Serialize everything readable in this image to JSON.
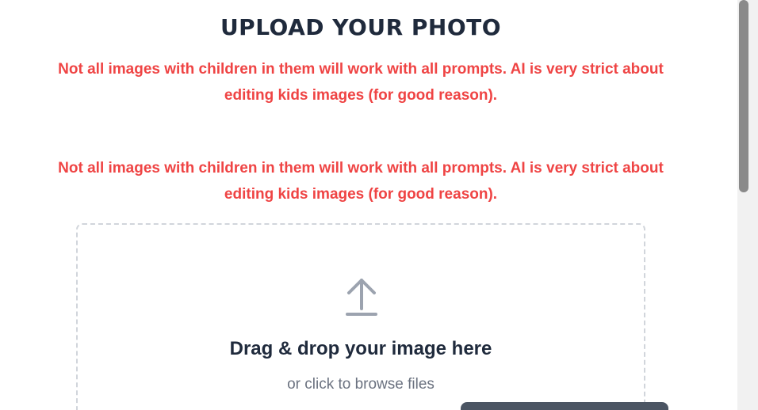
{
  "header": {
    "title": "Upload Your Photo"
  },
  "warnings": [
    "Not all images with children in them will work with all prompts. AI is very strict about editing kids images (for good reason).",
    "Not all images with children in them will work with all prompts. AI is very strict about editing kids images (for good reason)."
  ],
  "dropzone": {
    "icon": "upload-arrow-icon",
    "title": "Drag & drop your image here",
    "subtitle": "or click to browse files"
  },
  "colors": {
    "title": "#1f2a3c",
    "warning": "#ef4444",
    "subtitle": "#6b7280",
    "border": "#d1d5db",
    "icon": "#9ca3af"
  }
}
